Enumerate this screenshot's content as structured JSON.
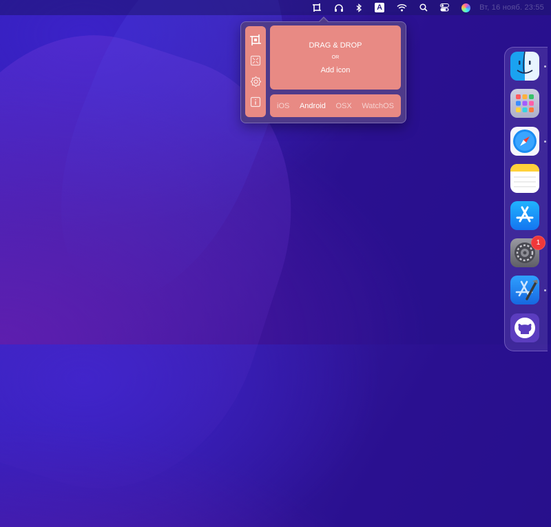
{
  "menubar": {
    "input_menu_letter": "A",
    "clock": "Вт, 16 нояб.  23:55"
  },
  "popover": {
    "tools": [
      "crop-icon",
      "resize-icon",
      "settings-icon",
      "info-icon"
    ],
    "drop_title": "DRAG & DROP",
    "drop_or": "OR",
    "drop_sub": "Add icon",
    "platforms": [
      "iOS",
      "Android",
      "OSX",
      "WatchOS"
    ],
    "active_platform": "Android",
    "accent_color": "#e88a84"
  },
  "dock": {
    "apps": [
      "finder",
      "launchpad",
      "safari",
      "notes",
      "app-store",
      "system-preferences",
      "xcode",
      "github"
    ],
    "system_preferences_badge": "1"
  }
}
